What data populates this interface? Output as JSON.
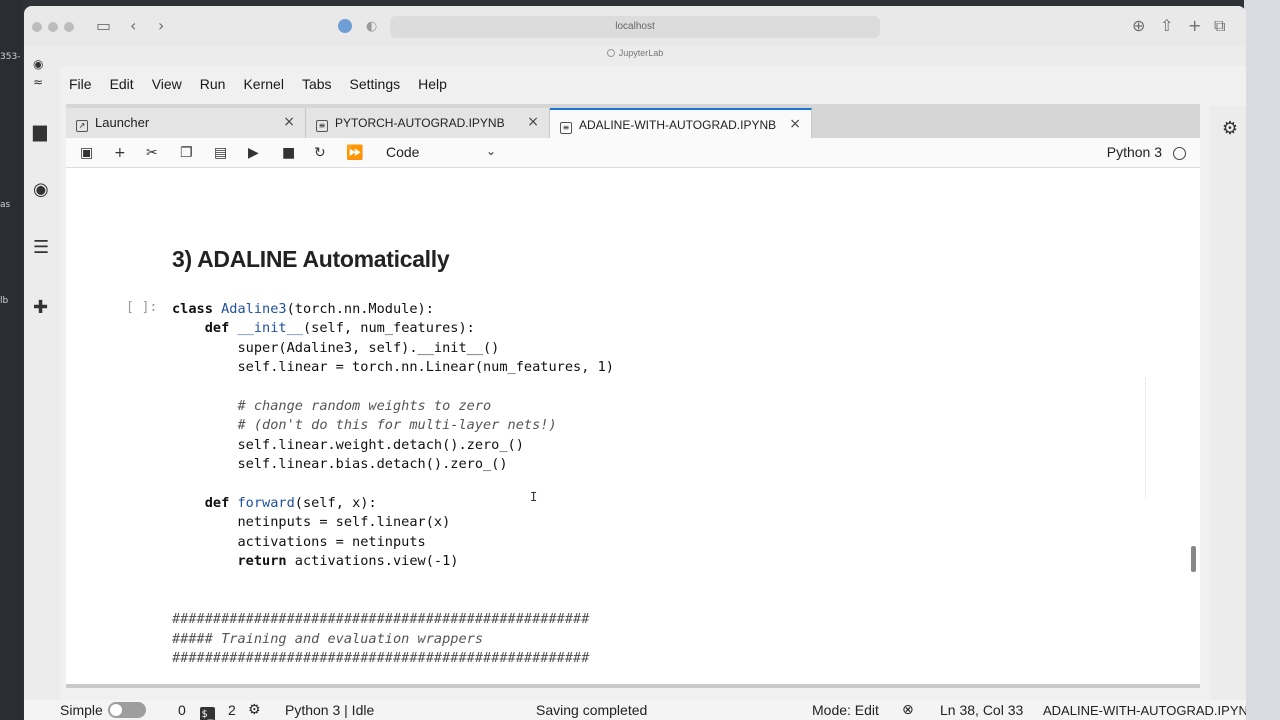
{
  "browser": {
    "url": "localhost",
    "page_title": "JupyterLab"
  },
  "desktop_fragments": [
    "353-",
    "as",
    "lb"
  ],
  "menu": [
    "File",
    "Edit",
    "View",
    "Run",
    "Kernel",
    "Tabs",
    "Settings",
    "Help"
  ],
  "tabs": [
    {
      "label": "Launcher",
      "active": false
    },
    {
      "label": "PYTORCH-AUTOGRAD.IPYNB",
      "active": false
    },
    {
      "label": "ADALINE-WITH-AUTOGRAD.IPYNB",
      "active": true
    }
  ],
  "toolbar": {
    "cell_type": "Code",
    "kernel": "Python 3"
  },
  "notebook": {
    "heading": "3) ADALINE Automatically",
    "prompt": "[ ]:",
    "code_lines": [
      [
        {
          "t": "class ",
          "c": "kw"
        },
        {
          "t": "Adaline3",
          "c": "fn"
        },
        {
          "t": "(torch.nn.Module):",
          "c": ""
        }
      ],
      [
        {
          "t": "    ",
          "c": ""
        },
        {
          "t": "def ",
          "c": "kw"
        },
        {
          "t": "__init__",
          "c": "fn"
        },
        {
          "t": "(self, num_features):",
          "c": ""
        }
      ],
      [
        {
          "t": "        super(Adaline3, self).__init__()",
          "c": ""
        }
      ],
      [
        {
          "t": "        self.linear = torch.nn.Linear(num_features, 1)",
          "c": ""
        }
      ],
      [
        {
          "t": "",
          "c": ""
        }
      ],
      [
        {
          "t": "        # change random weights to zero",
          "c": "cm"
        }
      ],
      [
        {
          "t": "        # (don't do this for multi-layer nets!)",
          "c": "cm"
        }
      ],
      [
        {
          "t": "        self.linear.weight.detach().zero_()",
          "c": ""
        }
      ],
      [
        {
          "t": "        self.linear.bias.detach().zero_()",
          "c": ""
        }
      ],
      [
        {
          "t": "",
          "c": ""
        }
      ],
      [
        {
          "t": "    ",
          "c": ""
        },
        {
          "t": "def ",
          "c": "kw"
        },
        {
          "t": "forward",
          "c": "fn"
        },
        {
          "t": "(self, x):",
          "c": ""
        }
      ],
      [
        {
          "t": "        netinputs = self.linear(x)",
          "c": ""
        }
      ],
      [
        {
          "t": "        activations = netinputs",
          "c": ""
        }
      ],
      [
        {
          "t": "        ",
          "c": ""
        },
        {
          "t": "return",
          "c": "kw"
        },
        {
          "t": " activations.view(-1)",
          "c": ""
        }
      ],
      [
        {
          "t": "",
          "c": ""
        }
      ],
      [
        {
          "t": "",
          "c": ""
        }
      ],
      [
        {
          "t": "###################################################",
          "c": "cm"
        }
      ],
      [
        {
          "t": "##### Training and evaluation wrappers",
          "c": "cm"
        }
      ],
      [
        {
          "t": "###################################################",
          "c": "cm"
        }
      ]
    ]
  },
  "status": {
    "mode_label": "Simple",
    "terminals": "0",
    "kernels": "2",
    "kernel_status": "Python 3 | Idle",
    "save_status": "Saving completed",
    "mode": "Mode: Edit",
    "position": "Ln 38, Col 33",
    "filename": "ADALINE-WITH-AUTOGRAD.IPYNB"
  }
}
